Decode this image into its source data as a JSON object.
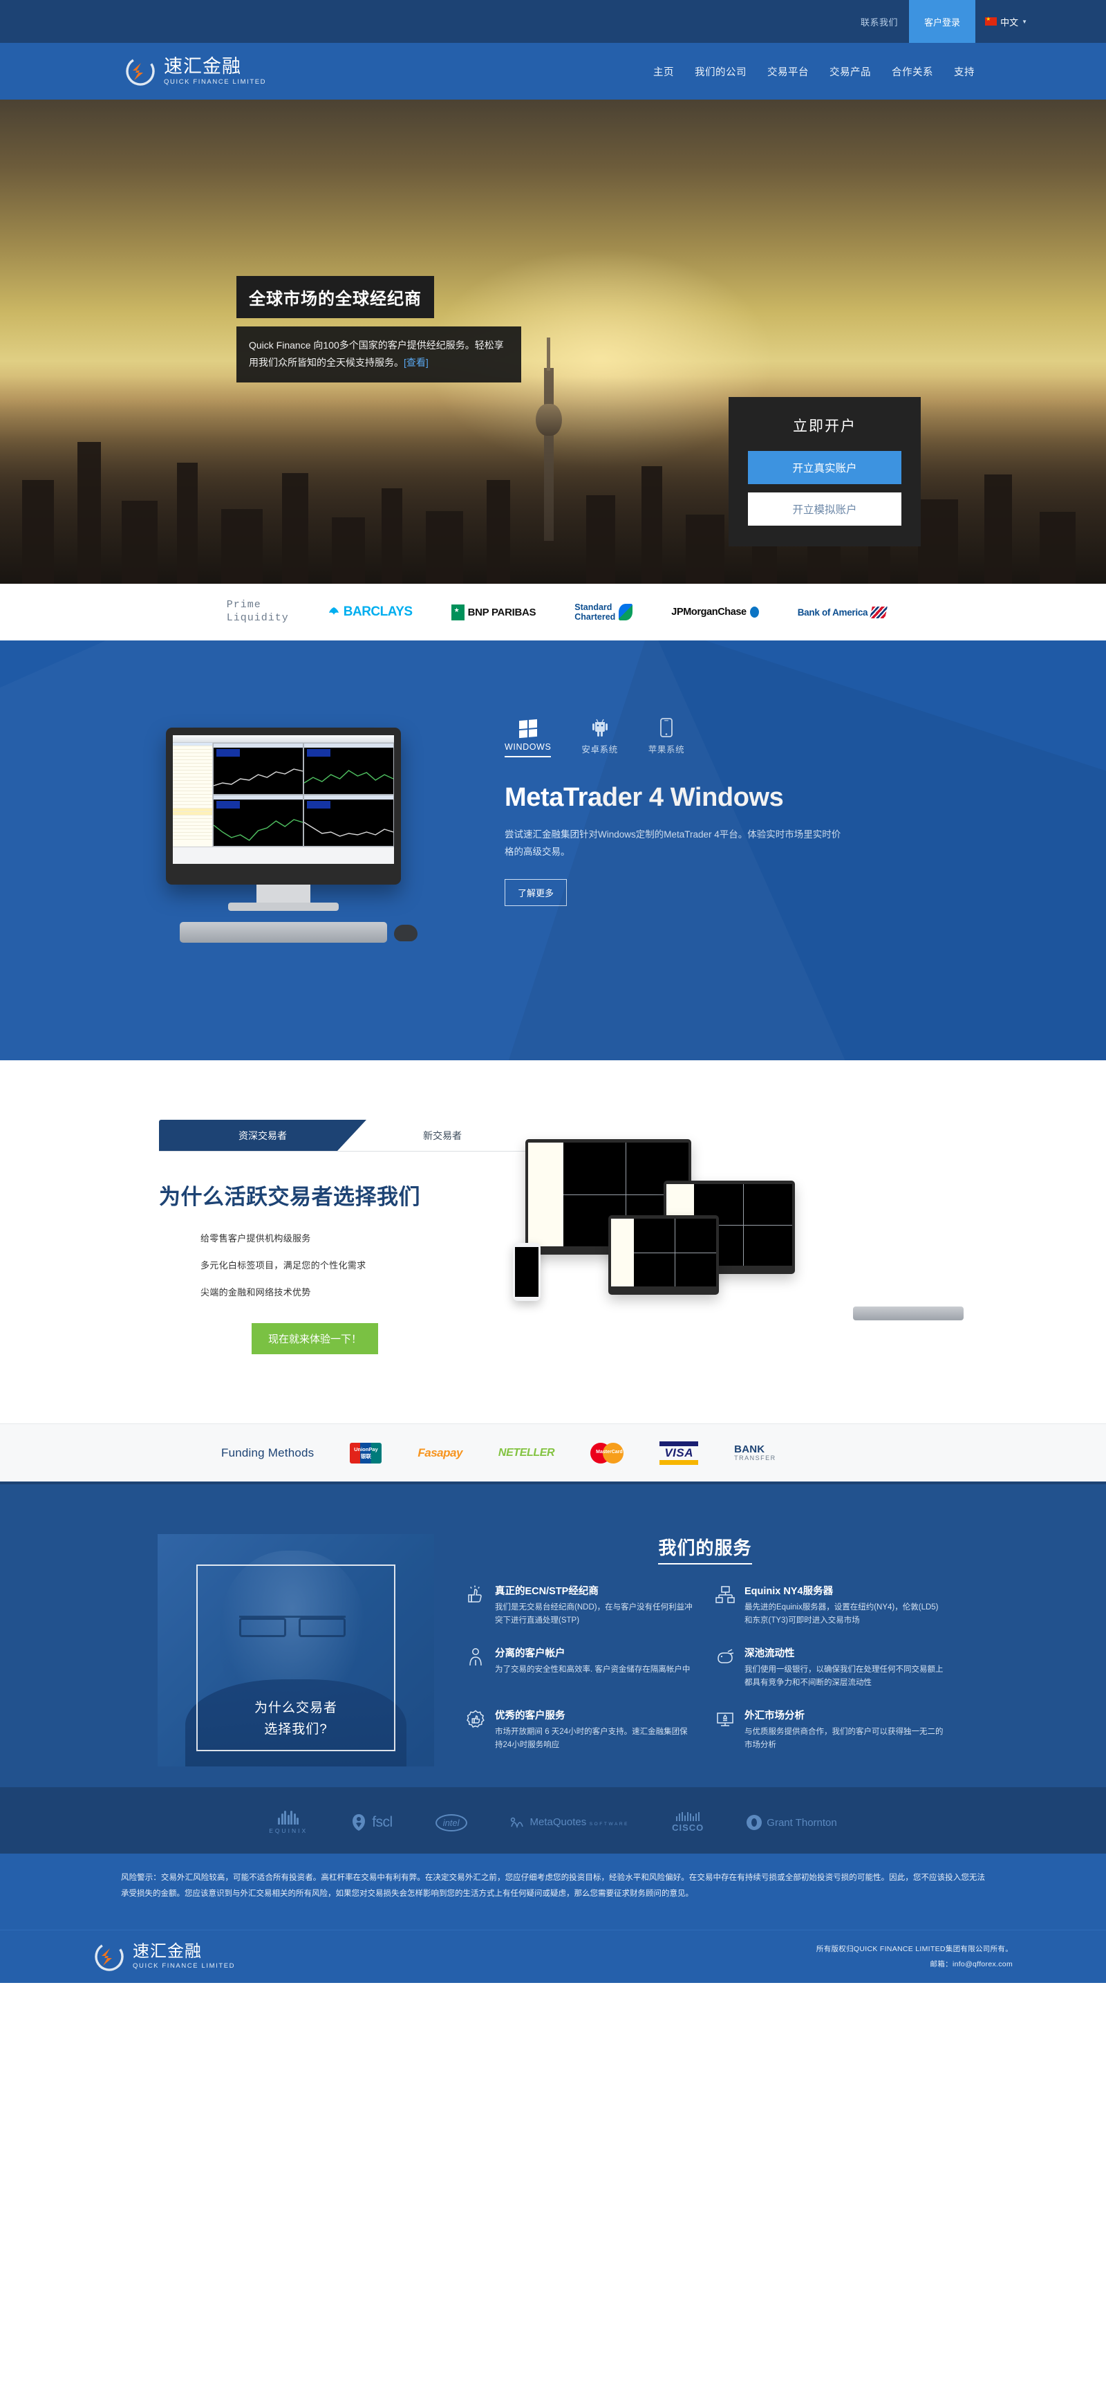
{
  "topbar": {
    "contact": "联系我们",
    "client_login": "客户登录",
    "language": "中文",
    "flag_icon": "china-flag-icon",
    "caret_icon": "chevron-down-icon"
  },
  "brand": {
    "cn": "速汇金融",
    "en": "QUICK FINANCE LIMITED",
    "logo_icon": "quick-finance-logo-icon"
  },
  "nav": {
    "items": [
      {
        "label": "主页"
      },
      {
        "label": "我们的公司"
      },
      {
        "label": "交易平台"
      },
      {
        "label": "交易产品"
      },
      {
        "label": "合作关系"
      },
      {
        "label": "支持"
      }
    ]
  },
  "hero": {
    "title": "全球市场的全球经纪商",
    "body": "Quick Finance 向100多个国家的客户提供经纪服务。轻松享用我们众所皆知的全天候支持服务。",
    "link": "[查看]",
    "account_box": {
      "title": "立即开户",
      "live_button": "开立真实账户",
      "demo_button": "开立模拟账户"
    }
  },
  "banks": {
    "prime_line1": "Prime",
    "prime_line2": "Liquidity",
    "items": [
      {
        "name": "BARCLAYS",
        "icon": "barclays-logo-icon"
      },
      {
        "name": "BNP PARIBAS",
        "icon": "bnp-paribas-logo-icon"
      },
      {
        "name_line1": "Standard",
        "name_line2": "Chartered",
        "icon": "standard-chartered-logo-icon"
      },
      {
        "name": "JPMorganChase",
        "icon": "jpmorgan-chase-logo-icon"
      },
      {
        "name": "Bank of America",
        "icon": "bank-of-america-logo-icon"
      }
    ]
  },
  "platform": {
    "os_tabs": [
      {
        "label": "WINDOWS",
        "icon": "windows-icon",
        "active": true
      },
      {
        "label": "安卓系统",
        "icon": "android-icon",
        "active": false
      },
      {
        "label": "苹果系统",
        "icon": "apple-phone-icon",
        "active": false
      }
    ],
    "title": "MetaTrader 4 Windows",
    "description": "尝试速汇金融集团针对Windows定制的MetaTrader 4平台。体验实时市场里实时价格的高级交易。",
    "cta": "了解更多"
  },
  "why": {
    "tabs": [
      {
        "label": "资深交易者",
        "active": true
      },
      {
        "label": "新交易者",
        "active": false
      }
    ],
    "title": "为什么活跃交易者选择我们",
    "bullets": [
      "给零售客户提供机构级服务",
      "多元化白标签项目，满足您的个性化需求",
      "尖端的金融和网络技术优势"
    ],
    "cta": "现在就来体验一下！"
  },
  "funding": {
    "label": "Funding Methods",
    "methods": [
      {
        "name": "UnionPay",
        "sub": "银联",
        "icon": "unionpay-logo-icon"
      },
      {
        "name": "Fasapay",
        "icon": "fasapay-logo-icon"
      },
      {
        "name": "NETELLER",
        "icon": "neteller-logo-icon"
      },
      {
        "name": "MasterCard",
        "icon": "mastercard-logo-icon"
      },
      {
        "name": "VISA",
        "icon": "visa-logo-icon"
      },
      {
        "name": "BANK",
        "sub": "TRANSFER",
        "icon": "bank-transfer-icon"
      }
    ]
  },
  "services": {
    "photo_caption_line1": "为什么交易者",
    "photo_caption_line2": "选择我们?",
    "heading": "我们的服务",
    "items": [
      {
        "icon": "thumbs-up-burst-icon",
        "title": "真正的ECN/STP经纪商",
        "desc": "我们是无交易台经纪商(NDD)，在与客户没有任何利益冲突下进行直通处理(STP)"
      },
      {
        "icon": "servers-network-icon",
        "title": "Equinix NY4服务器",
        "desc": "最先进的Equinix服务器，设置在纽约(NY4)，伦敦(LD5)和东京(TY3)可即时进入交易市场"
      },
      {
        "icon": "person-shield-icon",
        "title": "分离的客户帐户",
        "desc": "为了交易的安全性和高效率. 客户资金储存在隔离帐户中"
      },
      {
        "icon": "liquidity-pool-icon",
        "title": "深池流动性",
        "desc": "我们使用一级银行，以确保我们在处理任何不同交易额上都具有竞争力和不间断的深层流动性"
      },
      {
        "icon": "badge-thumbs-up-icon",
        "title": "优秀的客户服务",
        "desc": "市场开放期间 6 天24小时的客户支持。速汇金融集团保持24小时服务响应"
      },
      {
        "icon": "market-analysis-monitor-icon",
        "title": "外汇市场分析",
        "desc": "与优质服务提供商合作，我们的客户可以获得独一无二的市场分析"
      }
    ]
  },
  "partners": {
    "items": [
      {
        "name": "EQUINIX",
        "icon": "equinix-logo-icon"
      },
      {
        "name": "fscl",
        "icon": "fscl-logo-icon"
      },
      {
        "name": "intel",
        "icon": "intel-logo-icon"
      },
      {
        "name": "MetaQuotes",
        "sub": "SOFTWARE",
        "icon": "metaquotes-logo-icon"
      },
      {
        "name": "CISCO",
        "icon": "cisco-logo-icon"
      },
      {
        "name": "Grant Thornton",
        "icon": "grant-thornton-logo-icon"
      }
    ]
  },
  "risk": {
    "text": "风险警示：交易外汇风险较高，可能不适合所有投资者。高杠杆率在交易中有利有弊。在决定交易外汇之前，您应仔细考虑您的投资目标，经验水平和风险偏好。在交易中存在有持续亏损或全部初始投资亏损的可能性。因此，您不应该投入您无法承受损失的金额。您应该意识到与外汇交易相关的所有风险，如果您对交易损失会怎样影响到您的生活方式上有任何疑问或疑虑，那么您需要征求财务顾问的意见。"
  },
  "footer": {
    "copyright": "所有版权归QUICK FINANCE LIMITED集团有限公司所有。",
    "email": "邮箱：info@qfforex.com"
  },
  "colors": {
    "topbar_navy": "#1d4374",
    "header_blue": "#2560ab",
    "accent_blue": "#3d93e0",
    "green_cta": "#7ac143",
    "services_blue": "#22528e"
  }
}
